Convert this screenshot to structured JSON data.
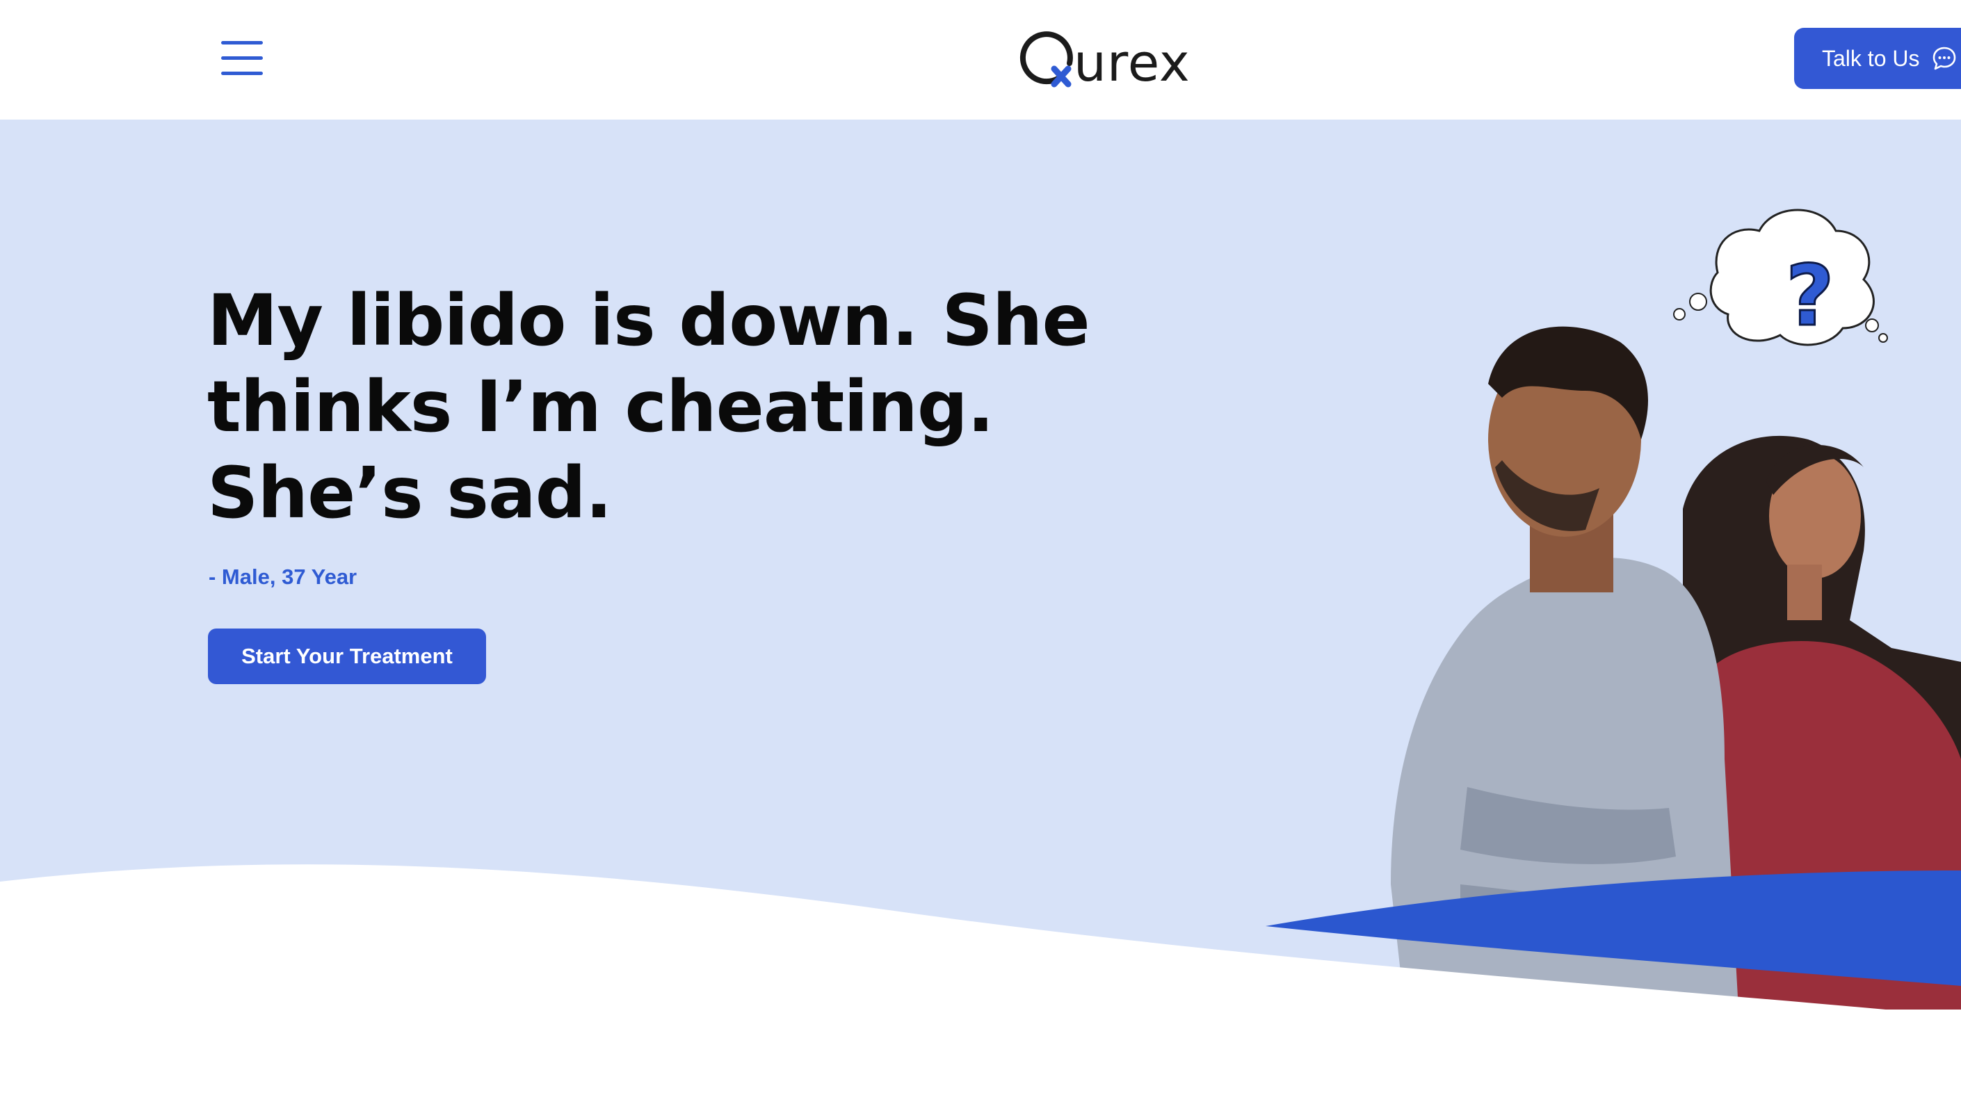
{
  "header": {
    "brand": "urex",
    "talk_label": "Talk to Us"
  },
  "hero": {
    "headline_lines": [
      "My libido is down. She",
      "thinks I’m cheating.",
      "She’s sad."
    ],
    "attribution": "- Male, 37 Year",
    "cta_label": "Start Your Treatment"
  },
  "icons": {
    "menu": "hamburger-menu-icon",
    "chat": "chat-bubble-icon",
    "question": "question-mark-icon"
  },
  "colors": {
    "accent": "#3358d4",
    "hero_bg": "#d7e2f8",
    "text": "#0a0a0a"
  }
}
